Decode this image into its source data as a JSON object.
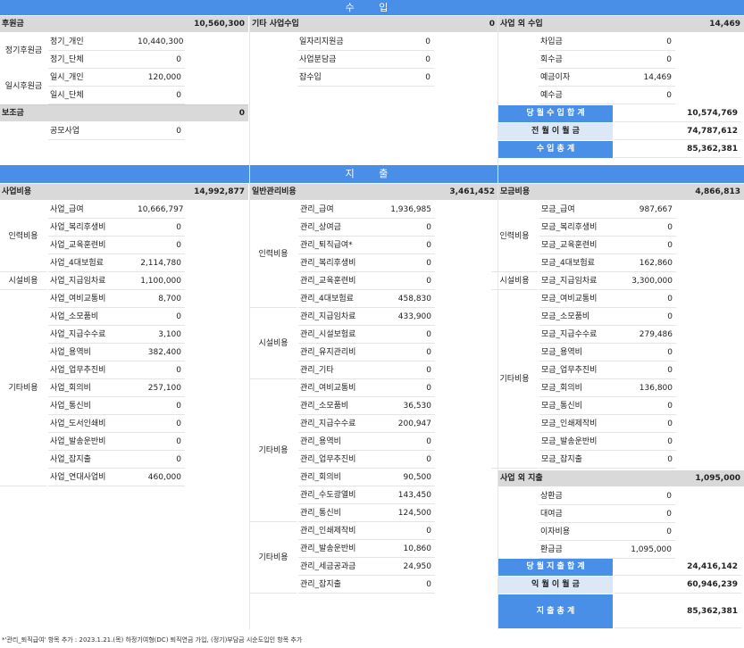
{
  "income": {
    "header": "수 입",
    "support": {
      "title": "후원금",
      "total": "10,560,300"
    },
    "regular": {
      "label": "정기후원금",
      "rows": [
        {
          "n": "정기_개인",
          "v": "10,440,300"
        },
        {
          "n": "정기_단체",
          "v": "0"
        }
      ]
    },
    "temp": {
      "label": "일시후원금",
      "rows": [
        {
          "n": "일시_개인",
          "v": "120,000"
        },
        {
          "n": "일시_단체",
          "v": "0"
        }
      ]
    },
    "subsidy": {
      "title": "보조금",
      "total": "0",
      "rows": [
        {
          "n": "공모사업",
          "v": "0"
        }
      ]
    },
    "other": {
      "title": "기타 사업수입",
      "total": "0",
      "rows": [
        {
          "n": "일자리지원금",
          "v": "0"
        },
        {
          "n": "사업분담금",
          "v": "0"
        },
        {
          "n": "잡수입",
          "v": "0"
        }
      ]
    },
    "nonop": {
      "title": "사업 외 수입",
      "total": "14,469",
      "rows": [
        {
          "n": "차입금",
          "v": "0"
        },
        {
          "n": "회수금",
          "v": "0"
        },
        {
          "n": "예금이자",
          "v": "14,469"
        },
        {
          "n": "예수금",
          "v": "0"
        }
      ]
    },
    "summary": [
      {
        "label": "당 월 수 입 합 계",
        "value": "10,574,769"
      },
      {
        "label": "전 월 이 월 금",
        "value": "74,787,612"
      },
      {
        "label": "수 입 총 계",
        "value": "85,362,381"
      }
    ]
  },
  "expense": {
    "header": "지 출",
    "business": {
      "title": "사업비용",
      "total": "14,992,877",
      "groups": [
        {
          "label": "인력비용",
          "rows": [
            {
              "n": "사업_급여",
              "v": "10,666,797"
            },
            {
              "n": "사업_복리후생비",
              "v": "0"
            },
            {
              "n": "사업_교육훈련비",
              "v": "0"
            },
            {
              "n": "사업_4대보험료",
              "v": "2,114,780"
            }
          ]
        },
        {
          "label": "시설비용",
          "rows": [
            {
              "n": "사업_지급임차료",
              "v": "1,100,000"
            }
          ]
        },
        {
          "label": "기타비용",
          "rows": [
            {
              "n": "사업_여비교통비",
              "v": "8,700"
            },
            {
              "n": "사업_소모품비",
              "v": "0"
            },
            {
              "n": "사업_지급수수료",
              "v": "3,100"
            },
            {
              "n": "사업_용역비",
              "v": "382,400"
            },
            {
              "n": "사업_업무추진비",
              "v": "0"
            },
            {
              "n": "사업_회의비",
              "v": "257,100"
            },
            {
              "n": "사업_통신비",
              "v": "0"
            },
            {
              "n": "사업_도서인쇄비",
              "v": "0"
            },
            {
              "n": "사업_발송운반비",
              "v": "0"
            },
            {
              "n": "사업_잡지출",
              "v": "0"
            },
            {
              "n": "사업_연대사업비",
              "v": "460,000"
            }
          ]
        }
      ]
    },
    "general": {
      "title": "일반관리비용",
      "total": "3,461,452",
      "groups": [
        {
          "label": "인력비용",
          "rows": [
            {
              "n": "관리_급여",
              "v": "1,936,985"
            },
            {
              "n": "관리_상여금",
              "v": "0"
            },
            {
              "n": "관리_퇴직급여*",
              "v": "0"
            },
            {
              "n": "관리_복리후생비",
              "v": "0"
            },
            {
              "n": "관리_교육훈련비",
              "v": "0"
            },
            {
              "n": "관리_4대보험료",
              "v": "458,830"
            }
          ]
        },
        {
          "label": "시설비용",
          "rows": [
            {
              "n": "관리_지급임차료",
              "v": "433,900"
            },
            {
              "n": "관리_시설보험료",
              "v": "0"
            },
            {
              "n": "관리_유지관리비",
              "v": "0"
            },
            {
              "n": "관리_기타",
              "v": "0"
            }
          ]
        },
        {
          "label": "기타비용",
          "rows": [
            {
              "n": "관리_여비교통비",
              "v": "0"
            },
            {
              "n": "관리_소모품비",
              "v": "36,530"
            },
            {
              "n": "관리_지급수수료",
              "v": "200,947"
            },
            {
              "n": "관리_용역비",
              "v": "0"
            },
            {
              "n": "관리_업무추진비",
              "v": "0"
            },
            {
              "n": "관리_회의비",
              "v": "90,500"
            },
            {
              "n": "관리_수도광열비",
              "v": "143,450"
            },
            {
              "n": "관리_통신비",
              "v": "124,500"
            }
          ]
        },
        {
          "label": "기타비용",
          "rows": [
            {
              "n": "관리_인쇄제작비",
              "v": "0"
            },
            {
              "n": "관리_발송운반비",
              "v": "10,860"
            },
            {
              "n": "관리_세금공과금",
              "v": "24,950"
            },
            {
              "n": "관리_잡지출",
              "v": "0"
            }
          ]
        }
      ]
    },
    "fundraising": {
      "title": "모금비용",
      "total": "4,866,813",
      "groups": [
        {
          "label": "인력비용",
          "rows": [
            {
              "n": "모금_급여",
              "v": "987,667"
            },
            {
              "n": "모금_복리후생비",
              "v": "0"
            },
            {
              "n": "모금_교육훈련비",
              "v": "0"
            },
            {
              "n": "모금_4대보험료",
              "v": "162,860"
            }
          ]
        },
        {
          "label": "시설비용",
          "rows": [
            {
              "n": "모금_지급임차료",
              "v": "3,300,000"
            }
          ]
        },
        {
          "label": "기타비용",
          "rows": [
            {
              "n": "모금_여비교통비",
              "v": "0"
            },
            {
              "n": "모금_소모품비",
              "v": "0"
            },
            {
              "n": "모금_지급수수료",
              "v": "279,486"
            },
            {
              "n": "모금_용역비",
              "v": "0"
            },
            {
              "n": "모금_업무추진비",
              "v": "0"
            },
            {
              "n": "모금_회의비",
              "v": "136,800"
            },
            {
              "n": "모금_통신비",
              "v": "0"
            },
            {
              "n": "모금_인쇄제작비",
              "v": "0"
            },
            {
              "n": "모금_발송운반비",
              "v": "0"
            },
            {
              "n": "모금_잡지출",
              "v": "0"
            }
          ]
        }
      ]
    },
    "nonop": {
      "title": "사업 외 지출",
      "total": "1,095,000",
      "rows": [
        {
          "n": "상환금",
          "v": "0"
        },
        {
          "n": "대여금",
          "v": "0"
        },
        {
          "n": "이자비용",
          "v": "0"
        },
        {
          "n": "환급금",
          "v": "1,095,000"
        }
      ]
    },
    "summary": [
      {
        "label": "당 월 지 출 합 계",
        "value": "24,416,142"
      },
      {
        "label": "익 월 이 월 금",
        "value": "60,946,239"
      },
      {
        "label": "지 출 총 계",
        "value": "85,362,381"
      }
    ]
  },
  "footnote": "*'관리_퇴직급여' 항목 추가 : 2023.1.21.(목) 하정기여형(DC) 퇴직연금 가입, (정기)부담금 시순도입인 항목 추가"
}
